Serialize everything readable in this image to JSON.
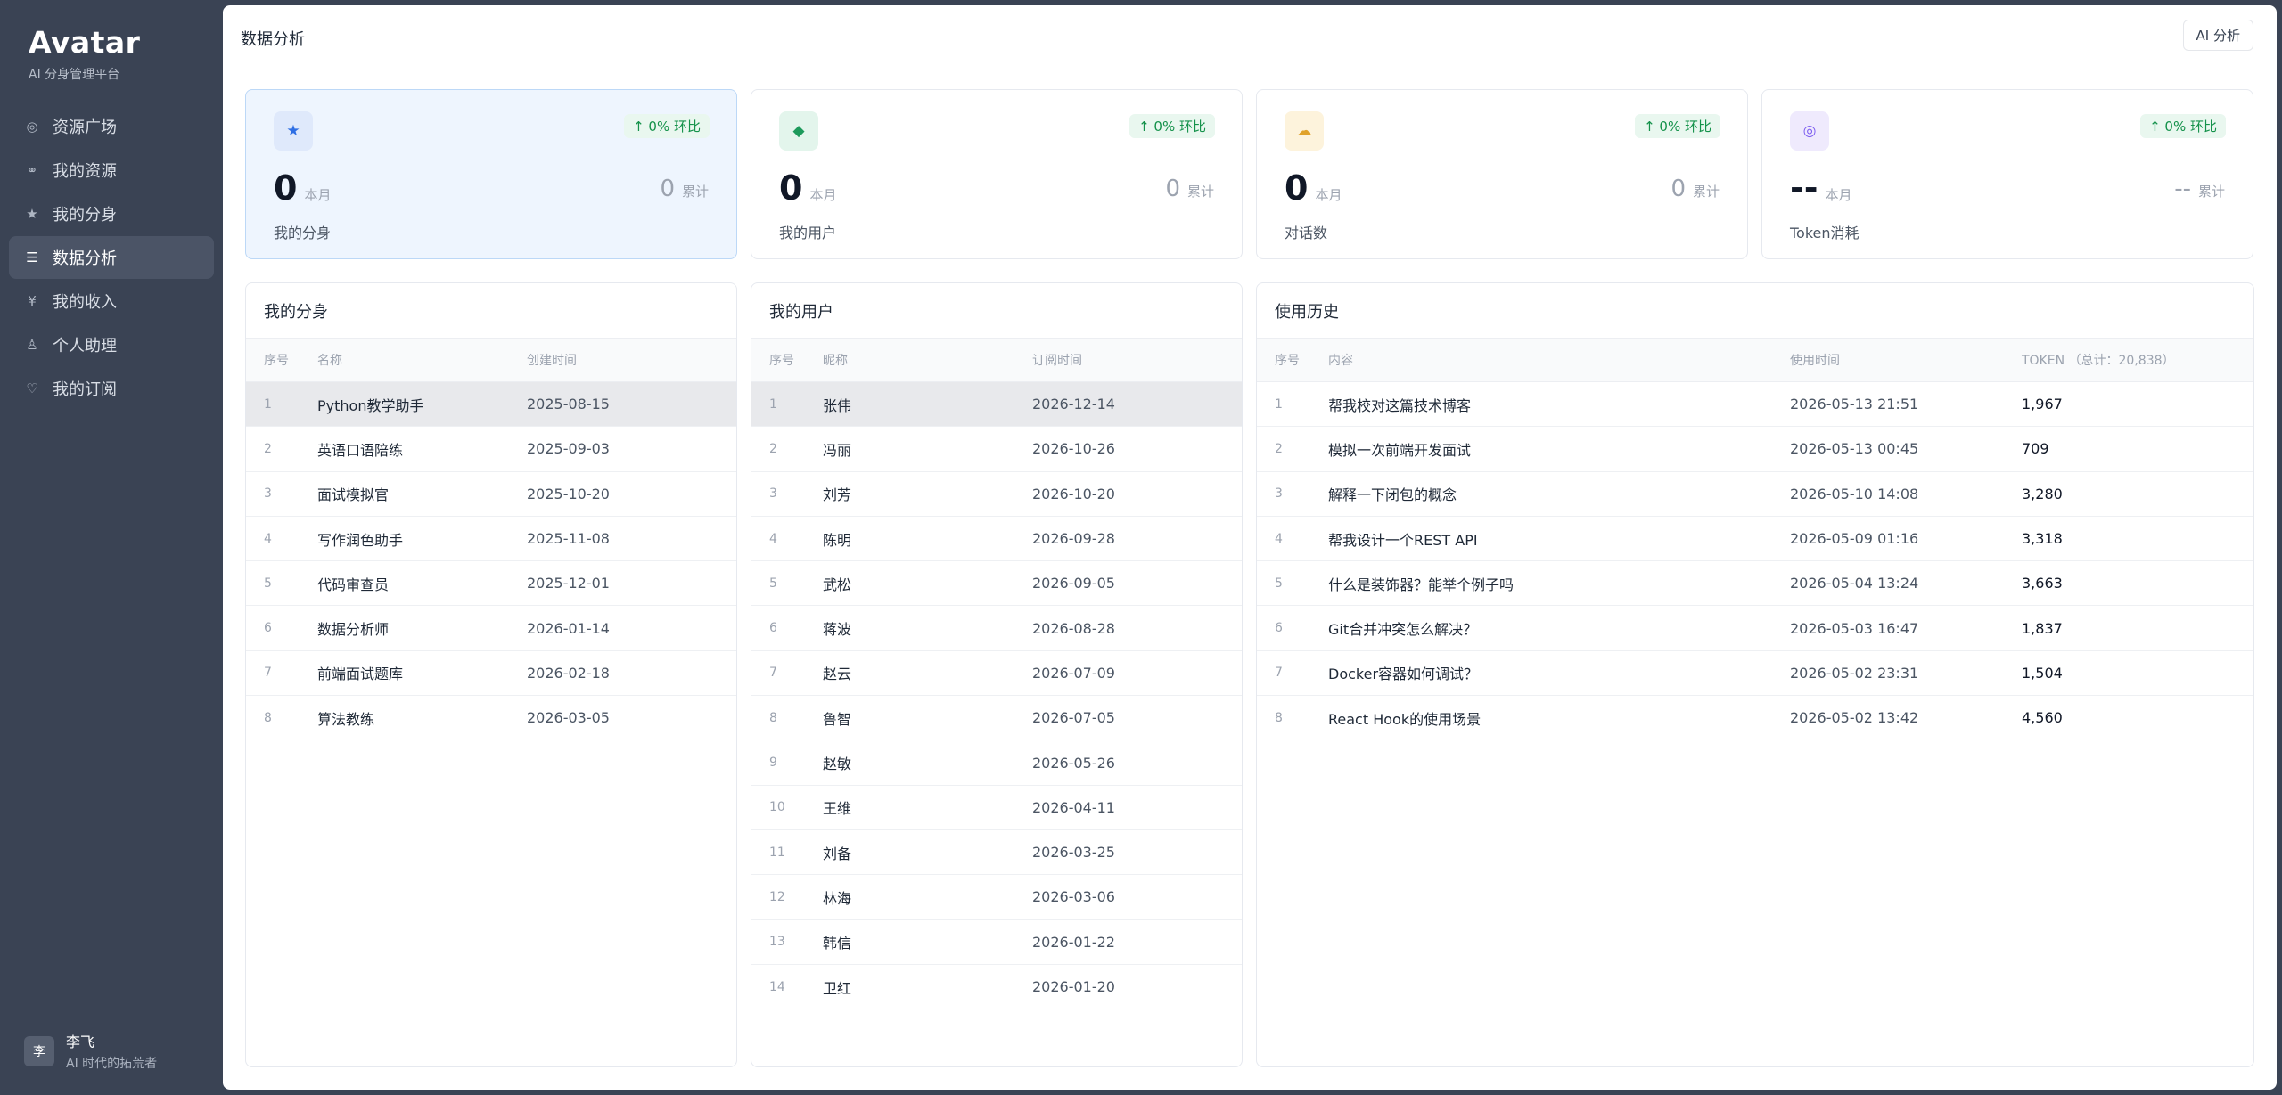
{
  "brand": {
    "title": "Avatar",
    "subtitle": "AI 分身管理平台"
  },
  "nav": [
    {
      "label": "资源广场",
      "icon": "compass-icon",
      "glyph": "◎"
    },
    {
      "label": "我的资源",
      "icon": "link-icon",
      "glyph": "⚭"
    },
    {
      "label": "我的分身",
      "icon": "star-icon",
      "glyph": "★"
    },
    {
      "label": "数据分析",
      "icon": "list-icon",
      "glyph": "☰"
    },
    {
      "label": "我的收入",
      "icon": "yen-icon",
      "glyph": "¥"
    },
    {
      "label": "个人助理",
      "icon": "person-icon",
      "glyph": "♙"
    },
    {
      "label": "我的订阅",
      "icon": "heart-icon",
      "glyph": "♡"
    }
  ],
  "user": {
    "avatar_text": "李",
    "name": "李飞",
    "subtitle": "AI 时代的拓荒者"
  },
  "header": {
    "title": "数据分析",
    "ai_button": "AI 分析"
  },
  "stats": [
    {
      "icon": "star-icon",
      "glyph": "★",
      "icon_bg": "#dfe9fb",
      "icon_color": "#2f6fe4",
      "badge": "↑ 0% 环比",
      "month_value": "0",
      "month_label": "本月",
      "total_value": "0",
      "total_label": "累计",
      "label": "我的分身"
    },
    {
      "icon": "diamond-icon",
      "glyph": "◆",
      "icon_bg": "#e3f5ec",
      "icon_color": "#1d9a5b",
      "badge": "↑ 0% 环比",
      "month_value": "0",
      "month_label": "本月",
      "total_value": "0",
      "total_label": "累计",
      "label": "我的用户"
    },
    {
      "icon": "cloud-icon",
      "glyph": "☁",
      "icon_bg": "#fdf3dc",
      "icon_color": "#e0a22b",
      "badge": "↑ 0% 环比",
      "month_value": "0",
      "month_label": "本月",
      "total_value": "0",
      "total_label": "累计",
      "label": "对话数"
    },
    {
      "icon": "target-icon",
      "glyph": "◎",
      "icon_bg": "#efeafd",
      "icon_color": "#7c5cf0",
      "badge": "↑ 0% 环比",
      "month_value": "--",
      "month_label": "本月",
      "total_value": "--",
      "total_label": "累计",
      "label": "Token消耗"
    }
  ],
  "avatars_table": {
    "title": "我的分身",
    "headers": [
      "序号",
      "名称",
      "创建时间"
    ],
    "rows": [
      [
        "1",
        "Python教学助手",
        "2025-08-15"
      ],
      [
        "2",
        "英语口语陪练",
        "2025-09-03"
      ],
      [
        "3",
        "面试模拟官",
        "2025-10-20"
      ],
      [
        "4",
        "写作润色助手",
        "2025-11-08"
      ],
      [
        "5",
        "代码审查员",
        "2025-12-01"
      ],
      [
        "6",
        "数据分析师",
        "2026-01-14"
      ],
      [
        "7",
        "前端面试题库",
        "2026-02-18"
      ],
      [
        "8",
        "算法教练",
        "2026-03-05"
      ]
    ]
  },
  "users_table": {
    "title": "我的用户",
    "headers": [
      "序号",
      "昵称",
      "订阅时间"
    ],
    "rows": [
      [
        "1",
        "张伟",
        "2026-12-14"
      ],
      [
        "2",
        "冯丽",
        "2026-10-26"
      ],
      [
        "3",
        "刘芳",
        "2026-10-20"
      ],
      [
        "4",
        "陈明",
        "2026-09-28"
      ],
      [
        "5",
        "武松",
        "2026-09-05"
      ],
      [
        "6",
        "蒋波",
        "2026-08-28"
      ],
      [
        "7",
        "赵云",
        "2026-07-09"
      ],
      [
        "8",
        "鲁智",
        "2026-07-05"
      ],
      [
        "9",
        "赵敏",
        "2026-05-26"
      ],
      [
        "10",
        "王维",
        "2026-04-11"
      ],
      [
        "11",
        "刘备",
        "2026-03-25"
      ],
      [
        "12",
        "林海",
        "2026-03-06"
      ],
      [
        "13",
        "韩信",
        "2026-01-22"
      ],
      [
        "14",
        "卫红",
        "2026-01-20"
      ]
    ]
  },
  "history_table": {
    "title": "使用历史",
    "headers": [
      "序号",
      "内容",
      "使用时间",
      "TOKEN （总计：20,838）"
    ],
    "rows": [
      [
        "1",
        "帮我校对这篇技术博客",
        "2026-05-13 21:51",
        "1,967"
      ],
      [
        "2",
        "模拟一次前端开发面试",
        "2026-05-13 00:45",
        "709"
      ],
      [
        "3",
        "解释一下闭包的概念",
        "2026-05-10 14:08",
        "3,280"
      ],
      [
        "4",
        "帮我设计一个REST API",
        "2026-05-09 01:16",
        "3,318"
      ],
      [
        "5",
        "什么是装饰器？能举个例子吗",
        "2026-05-04 13:24",
        "3,663"
      ],
      [
        "6",
        "Git合并冲突怎么解决？",
        "2026-05-03 16:47",
        "1,837"
      ],
      [
        "7",
        "Docker容器如何调试？",
        "2026-05-02 23:31",
        "1,504"
      ],
      [
        "8",
        "React Hook的使用场景",
        "2026-05-02 13:42",
        "4,560"
      ]
    ]
  }
}
